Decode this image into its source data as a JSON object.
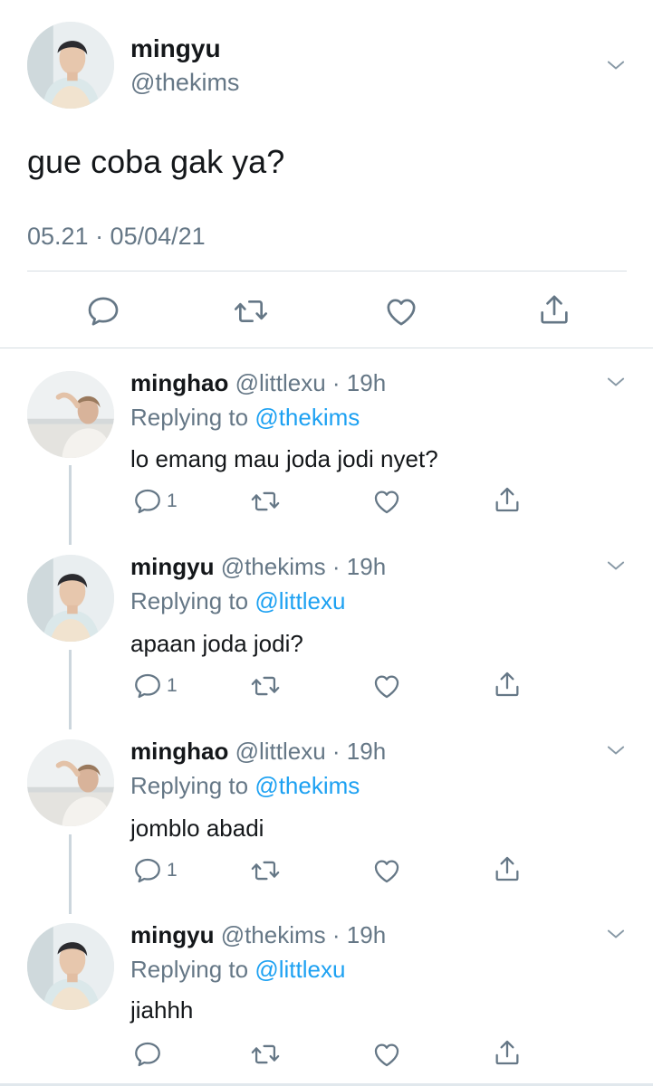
{
  "main_tweet": {
    "display_name": "mingyu",
    "handle": "@thekims",
    "text": "gue coba gak ya?",
    "timestamp": "05.21 · 05/04/21",
    "icons": [
      "reply-icon",
      "retweet-icon",
      "like-icon",
      "share-icon"
    ]
  },
  "replies": [
    {
      "display_name": "minghao",
      "handle": "@littlexu",
      "time": "· 19h",
      "replying_prefix": "Replying to",
      "replying_to": "@thekims",
      "text": "lo emang mau joda jodi nyet?",
      "reply_count": "1"
    },
    {
      "display_name": "mingyu",
      "handle": "@thekims",
      "time": "· 19h",
      "replying_prefix": "Replying to",
      "replying_to": "@littlexu",
      "text": "apaan joda jodi?",
      "reply_count": "1"
    },
    {
      "display_name": "minghao",
      "handle": "@littlexu",
      "time": "· 19h",
      "replying_prefix": "Replying to",
      "replying_to": "@thekims",
      "text": "jomblo abadi",
      "reply_count": "1"
    },
    {
      "display_name": "mingyu",
      "handle": "@thekims",
      "time": "· 19h",
      "replying_prefix": "Replying to",
      "replying_to": "@littlexu",
      "text": "jiahhh",
      "reply_count": ""
    }
  ],
  "colors": {
    "link": "#1da1f2",
    "secondary_text": "#657786",
    "primary_text": "#14171a",
    "divider": "#d6dde2"
  }
}
